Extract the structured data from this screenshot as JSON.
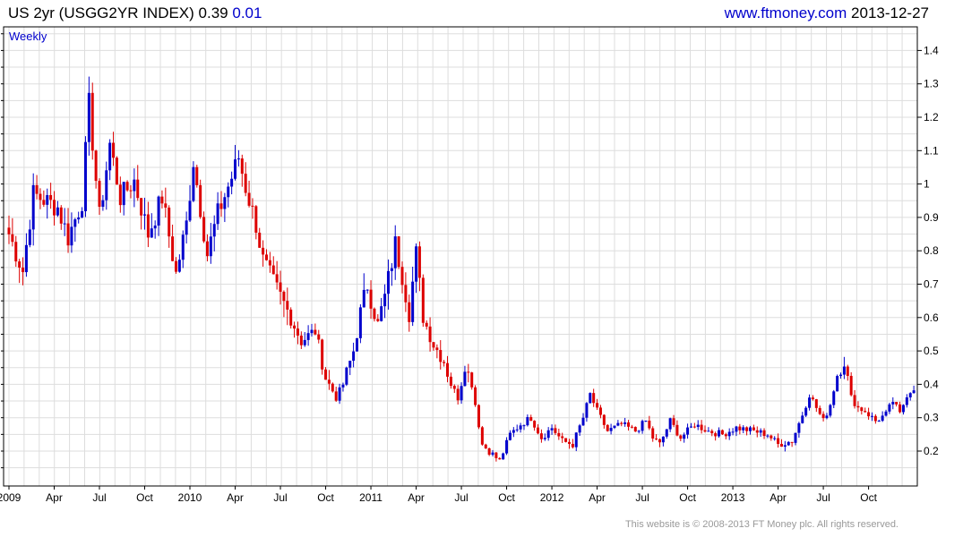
{
  "header": {
    "instrument": "US 2yr (USGG2YR INDEX)",
    "last": "0.39",
    "change": "0.01",
    "site": "www.ftmoney.com",
    "date": "2013-12-27"
  },
  "footer": {
    "copyright": "This website is © 2008-2013 FT Money plc. All rights reserved."
  },
  "colors": {
    "up": "#0000cc",
    "down": "#dd0000",
    "grid": "#dddddd",
    "frame": "#000000"
  },
  "chart_data": {
    "type": "candlestick",
    "title": "US 2yr (USGG2YR INDEX)",
    "interval": "Weekly",
    "y_ticks": [
      0.2,
      0.3,
      0.4,
      0.5,
      0.6,
      0.7,
      0.8,
      0.9,
      1.0,
      1.1,
      1.2,
      1.3,
      1.4
    ],
    "y_tick_labels": [
      "0.2",
      "0.3",
      "0.4",
      "0.5",
      "0.6",
      "0.7",
      "0.8",
      "0.9",
      "1",
      "1.1",
      "1.2",
      "1.3",
      "1.4"
    ],
    "ylim": [
      0.1,
      1.45
    ],
    "x_labels": [
      "2009",
      "Apr",
      "Jul",
      "Oct",
      "2010",
      "Apr",
      "Jul",
      "Oct",
      "2011",
      "Apr",
      "Jul",
      "Oct",
      "2012",
      "Apr",
      "Jul",
      "Oct",
      "2013",
      "Apr",
      "Jul",
      "Oct"
    ],
    "x_label_weeks": [
      0,
      13,
      26,
      39,
      52,
      65,
      78,
      91,
      104,
      117,
      130,
      143,
      156,
      169,
      182,
      195,
      208,
      221,
      234,
      247
    ],
    "weeks_total": 261,
    "grid": true,
    "close_path": [
      [
        0,
        0.85
      ],
      [
        4,
        0.74
      ],
      [
        7,
        0.97
      ],
      [
        14,
        0.93
      ],
      [
        17,
        0.84
      ],
      [
        21,
        0.95
      ],
      [
        23,
        1.24
      ],
      [
        26,
        0.9
      ],
      [
        29,
        1.12
      ],
      [
        32,
        0.96
      ],
      [
        36,
        1.01
      ],
      [
        40,
        0.85
      ],
      [
        44,
        0.96
      ],
      [
        48,
        0.73
      ],
      [
        51,
        0.88
      ],
      [
        53,
        1.07
      ],
      [
        57,
        0.79
      ],
      [
        60,
        0.91
      ],
      [
        64,
        1.02
      ],
      [
        66,
        1.08
      ],
      [
        68,
        0.99
      ],
      [
        71,
        0.88
      ],
      [
        73,
        0.77
      ],
      [
        76,
        0.7
      ],
      [
        80,
        0.62
      ],
      [
        84,
        0.53
      ],
      [
        88,
        0.56
      ],
      [
        91,
        0.42
      ],
      [
        94,
        0.36
      ],
      [
        96,
        0.4
      ],
      [
        99,
        0.5
      ],
      [
        101,
        0.61
      ],
      [
        103,
        0.7
      ],
      [
        106,
        0.58
      ],
      [
        108,
        0.66
      ],
      [
        111,
        0.82
      ],
      [
        113,
        0.73
      ],
      [
        115,
        0.62
      ],
      [
        117,
        0.79
      ],
      [
        119,
        0.6
      ],
      [
        122,
        0.52
      ],
      [
        125,
        0.47
      ],
      [
        127,
        0.4
      ],
      [
        129,
        0.36
      ],
      [
        131,
        0.46
      ],
      [
        133,
        0.4
      ],
      [
        136,
        0.22
      ],
      [
        139,
        0.19
      ],
      [
        141,
        0.17
      ],
      [
        144,
        0.25
      ],
      [
        147,
        0.28
      ],
      [
        150,
        0.3
      ],
      [
        153,
        0.24
      ],
      [
        156,
        0.27
      ],
      [
        159,
        0.23
      ],
      [
        162,
        0.22
      ],
      [
        165,
        0.3
      ],
      [
        167,
        0.37
      ],
      [
        169,
        0.32
      ],
      [
        172,
        0.26
      ],
      [
        176,
        0.28
      ],
      [
        180,
        0.26
      ],
      [
        183,
        0.29
      ],
      [
        185,
        0.24
      ],
      [
        187,
        0.22
      ],
      [
        190,
        0.29
      ],
      [
        193,
        0.24
      ],
      [
        197,
        0.28
      ],
      [
        201,
        0.26
      ],
      [
        205,
        0.25
      ],
      [
        209,
        0.27
      ],
      [
        214,
        0.26
      ],
      [
        218,
        0.25
      ],
      [
        221,
        0.22
      ],
      [
        225,
        0.23
      ],
      [
        228,
        0.31
      ],
      [
        230,
        0.37
      ],
      [
        232,
        0.33
      ],
      [
        234,
        0.29
      ],
      [
        236,
        0.34
      ],
      [
        238,
        0.43
      ],
      [
        240,
        0.47
      ],
      [
        242,
        0.36
      ],
      [
        244,
        0.33
      ],
      [
        246,
        0.32
      ],
      [
        249,
        0.29
      ],
      [
        252,
        0.31
      ],
      [
        254,
        0.35
      ],
      [
        256,
        0.31
      ],
      [
        258,
        0.37
      ],
      [
        260,
        0.39
      ]
    ]
  }
}
